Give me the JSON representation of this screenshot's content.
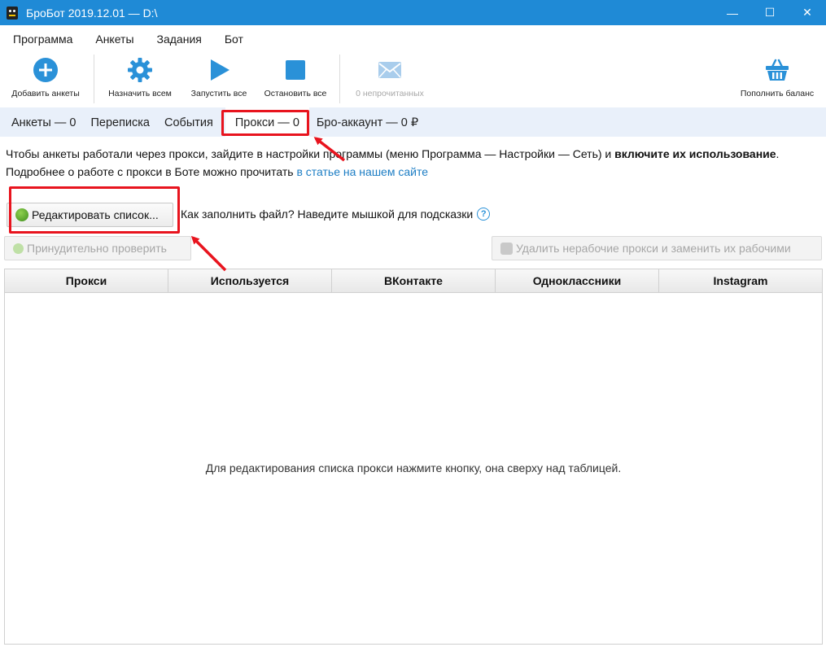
{
  "window": {
    "title": "БроБот 2019.12.01 — D:\\",
    "controls": {
      "minimize": "—",
      "maximize": "☐",
      "close": "✕"
    }
  },
  "menu": [
    "Программа",
    "Анкеты",
    "Задания",
    "Бот"
  ],
  "toolbar": {
    "add": "Добавить анкеты",
    "assign": "Назначить всем",
    "start": "Запустить все",
    "stop": "Остановить все",
    "unread": "0 непрочитанных",
    "balance": "Пополнить баланс"
  },
  "tabs": [
    "Анкеты — 0",
    "Переписка",
    "События",
    "Прокси — 0",
    "Бро-аккаунт — 0 ₽"
  ],
  "info": {
    "part1": "Чтобы анкеты работали через прокси, зайдите в настройки программы (меню Программа — Настройки — Сеть) и ",
    "bold": "включите их использование",
    "part2": ". Подробнее о работе с прокси в Боте можно прочитать ",
    "link": "в статье на нашем сайте"
  },
  "buttons": {
    "edit": "Редактировать список...",
    "hint": "Как заполнить файл? Наведите мышкой для подсказки",
    "help": "?",
    "check": "Принудительно проверить",
    "replace": "Удалить нерабочие прокси и заменить их рабочими"
  },
  "table": {
    "columns": [
      "Прокси",
      "Используется",
      "ВКонтакте",
      "Одноклассники",
      "Instagram"
    ],
    "empty": "Для редактирования списка прокси нажмите кнопку, она сверху над таблицей."
  },
  "colors": {
    "titlebar": "#1f8ad6",
    "accent": "#2a91d8",
    "annotation": "#e8141e"
  }
}
